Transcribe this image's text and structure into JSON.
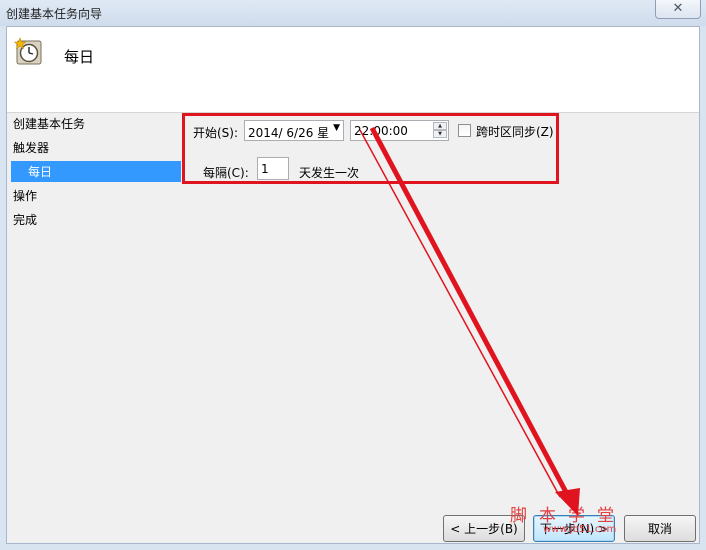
{
  "window": {
    "title": "创建基本任务向导",
    "close_glyph": "✕"
  },
  "header": {
    "title": "每日",
    "icon": "clock-icon"
  },
  "sidebar": {
    "items": [
      {
        "label": "创建基本任务"
      },
      {
        "label": "触发器"
      },
      {
        "label": "每日"
      },
      {
        "label": "操作"
      },
      {
        "label": "完成"
      }
    ],
    "selected_index": 2
  },
  "form": {
    "start_label": "开始(S):",
    "start_date": "2014/  6/26 星",
    "start_time": "22:00:00",
    "sync_timezone_label": "跨时区同步(Z)",
    "sync_timezone_checked": false,
    "interval_label": "每隔(C):",
    "interval_value": "1",
    "interval_suffix": "天发生一次"
  },
  "buttons": {
    "back": "< 上一步(B)",
    "next": "下一步(N) >",
    "cancel": "取消"
  },
  "annotation": {
    "color": "#e0141e"
  },
  "watermark": {
    "text": "脚本学堂",
    "url": "www.jb51.com"
  }
}
